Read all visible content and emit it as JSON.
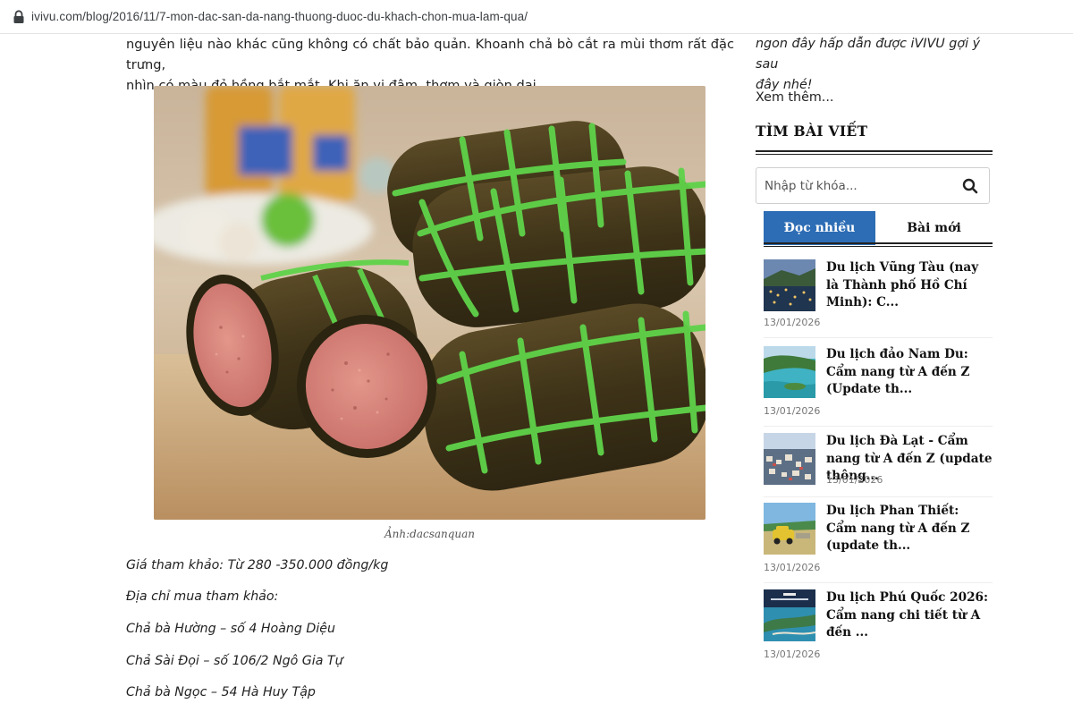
{
  "browser": {
    "url": "ivivu.com/blog/2016/11/7-mon-dac-san-da-nang-thuong-duoc-du-khach-chon-mua-lam-qua/"
  },
  "article": {
    "paragraph_line1": "nguyên liệu nào khác cũng không có chất bảo quản. Khoanh chả bò cắt ra mùi thơm rất đặc trưng,",
    "paragraph_line2": "nhìn có màu đỏ hồng bắt mắt. Khi ăn vị đậm, thơm và giòn dai.",
    "image_caption": "Ảnh:dacsanquan",
    "price": "Giá tham khảo: Từ 280 -350.000 đồng/kg",
    "address_heading": "Địa chỉ mua tham khảo:",
    "addresses": [
      "Chả bà Hường – số 4 Hoàng Diệu",
      "Chả Sài Đọi – số 106/2 Ngô Gia Tự",
      "Chả bà Ngọc – 54 Hà Huy Tập"
    ]
  },
  "sidebar": {
    "intro_line1": "ngon đây hấp dẫn được iVIVU gợi ý sau",
    "intro_line2": "đây nhé!",
    "read_more": "Xem thêm...",
    "search_title": "TÌM BÀI VIẾT",
    "search_placeholder": "Nhập từ khóa...",
    "tabs": [
      "Đọc nhiều",
      "Bài mới"
    ],
    "posts": [
      {
        "title": "Du lịch Vũng Tàu (nay là Thành phố Hồ Chí Minh): C...",
        "date": "13/01/2026"
      },
      {
        "title": "Du lịch đảo Nam Du: Cẩm nang từ A đến Z (Update th...",
        "date": "13/01/2026"
      },
      {
        "title": "Du lịch Đà Lạt - Cẩm nang từ A đến Z (update thông...",
        "date": "13/01/2026"
      },
      {
        "title": "Du lịch Phan Thiết: Cẩm nang từ A đến Z (update th...",
        "date": "13/01/2026"
      },
      {
        "title": "Du lịch Phú Quốc 2026: Cẩm nang chi tiết từ A đến ...",
        "date": "13/01/2026"
      }
    ]
  },
  "colors": {
    "tab_active": "#2d6db5",
    "leaf_green": "#5fd34a",
    "meat_pink": "#d98579"
  }
}
